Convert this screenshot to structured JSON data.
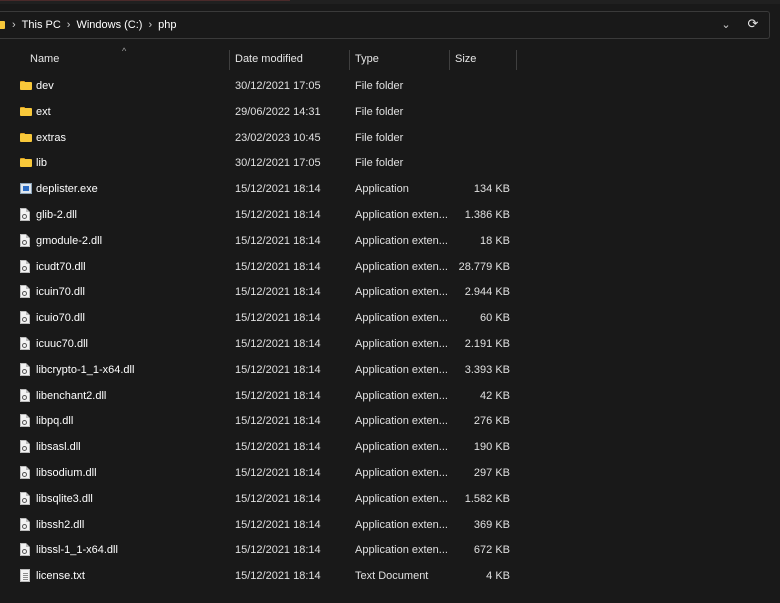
{
  "breadcrumb": {
    "items": [
      "This PC",
      "Windows (C:)",
      "php"
    ],
    "separator": "›"
  },
  "addressbar": {
    "dropdown_glyph": "⌄",
    "refresh_glyph": "⟳"
  },
  "columns": {
    "name": "Name",
    "date": "Date modified",
    "type": "Type",
    "size": "Size"
  },
  "sort_caret": "^",
  "files": [
    {
      "name": "dev",
      "date": "30/12/2021 17:05",
      "type": "File folder",
      "size": "",
      "icon": "folder-icon"
    },
    {
      "name": "ext",
      "date": "29/06/2022 14:31",
      "type": "File folder",
      "size": "",
      "icon": "folder-icon"
    },
    {
      "name": "extras",
      "date": "23/02/2023 10:45",
      "type": "File folder",
      "size": "",
      "icon": "folder-icon"
    },
    {
      "name": "lib",
      "date": "30/12/2021 17:05",
      "type": "File folder",
      "size": "",
      "icon": "folder-icon"
    },
    {
      "name": "deplister.exe",
      "date": "15/12/2021 18:14",
      "type": "Application",
      "size": "134 KB",
      "icon": "application-icon"
    },
    {
      "name": "glib-2.dll",
      "date": "15/12/2021 18:14",
      "type": "Application exten...",
      "size": "1.386 KB",
      "icon": "dll-file-icon"
    },
    {
      "name": "gmodule-2.dll",
      "date": "15/12/2021 18:14",
      "type": "Application exten...",
      "size": "18 KB",
      "icon": "dll-file-icon"
    },
    {
      "name": "icudt70.dll",
      "date": "15/12/2021 18:14",
      "type": "Application exten...",
      "size": "28.779 KB",
      "icon": "dll-file-icon"
    },
    {
      "name": "icuin70.dll",
      "date": "15/12/2021 18:14",
      "type": "Application exten...",
      "size": "2.944 KB",
      "icon": "dll-file-icon"
    },
    {
      "name": "icuio70.dll",
      "date": "15/12/2021 18:14",
      "type": "Application exten...",
      "size": "60 KB",
      "icon": "dll-file-icon"
    },
    {
      "name": "icuuc70.dll",
      "date": "15/12/2021 18:14",
      "type": "Application exten...",
      "size": "2.191 KB",
      "icon": "dll-file-icon"
    },
    {
      "name": "libcrypto-1_1-x64.dll",
      "date": "15/12/2021 18:14",
      "type": "Application exten...",
      "size": "3.393 KB",
      "icon": "dll-file-icon"
    },
    {
      "name": "libenchant2.dll",
      "date": "15/12/2021 18:14",
      "type": "Application exten...",
      "size": "42 KB",
      "icon": "dll-file-icon"
    },
    {
      "name": "libpq.dll",
      "date": "15/12/2021 18:14",
      "type": "Application exten...",
      "size": "276 KB",
      "icon": "dll-file-icon"
    },
    {
      "name": "libsasl.dll",
      "date": "15/12/2021 18:14",
      "type": "Application exten...",
      "size": "190 KB",
      "icon": "dll-file-icon"
    },
    {
      "name": "libsodium.dll",
      "date": "15/12/2021 18:14",
      "type": "Application exten...",
      "size": "297 KB",
      "icon": "dll-file-icon"
    },
    {
      "name": "libsqlite3.dll",
      "date": "15/12/2021 18:14",
      "type": "Application exten...",
      "size": "1.582 KB",
      "icon": "dll-file-icon"
    },
    {
      "name": "libssh2.dll",
      "date": "15/12/2021 18:14",
      "type": "Application exten...",
      "size": "369 KB",
      "icon": "dll-file-icon"
    },
    {
      "name": "libssl-1_1-x64.dll",
      "date": "15/12/2021 18:14",
      "type": "Application exten...",
      "size": "672 KB",
      "icon": "dll-file-icon"
    },
    {
      "name": "license.txt",
      "date": "15/12/2021 18:14",
      "type": "Text Document",
      "size": "4 KB",
      "icon": "text-file-icon"
    }
  ],
  "colors": {
    "background": "#191919",
    "text": "#ffffff",
    "folder": "#f8c83a",
    "border": "#3a3a3a"
  }
}
